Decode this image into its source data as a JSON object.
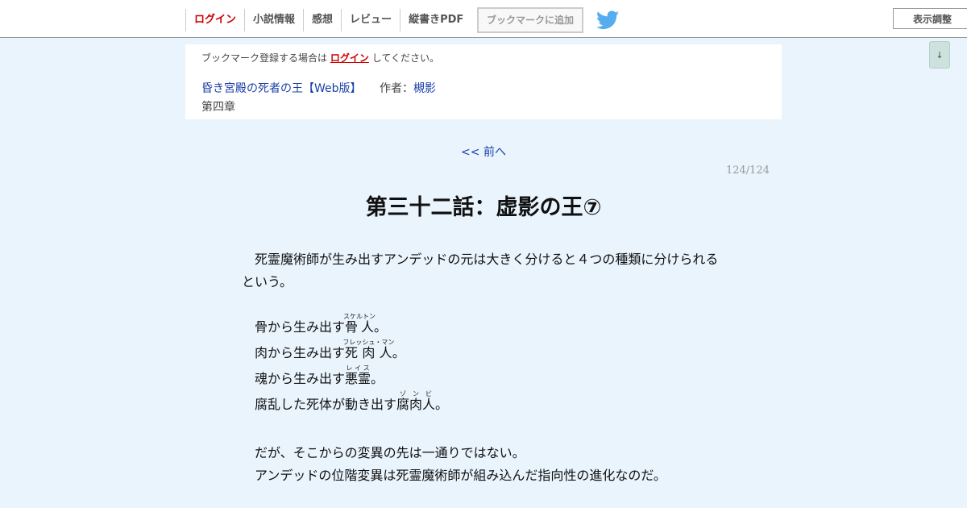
{
  "nav": {
    "items": [
      "ログイン",
      "小説情報",
      "感想",
      "レビュー",
      "縦書きPDF"
    ],
    "bookmark_button": "ブックマークに追加",
    "display_settings": "表示調整",
    "scroll_down": "↓"
  },
  "info": {
    "notice_prefix": "ブックマーク登録する場合は",
    "notice_link": "ログイン",
    "notice_suffix": "してください。",
    "series_title": "昏き宮殿の死者の王【Web版】",
    "author_label": "作者：",
    "author_name": "槻影",
    "chapter": "第四章"
  },
  "pager": {
    "prev": "<< 前へ",
    "page_count": "124/124"
  },
  "chapter_title": "第三十二話：虚影の王⑦",
  "body": {
    "p1_line1": "死霊魔術師が生み出すアンデッドの元は大きく分けると４つの種類に分けられる",
    "p1_line2": "という。",
    "l1_pre": "骨から生み出す",
    "l1_base": "骨人",
    "l1_ruby": "スケルトン",
    "l1_post": "。",
    "l2_pre": "肉から生み出す",
    "l2_base": "死肉人",
    "l2_ruby": "フレッシュ・マン",
    "l2_post": "。",
    "l3_pre": "魂から生み出す",
    "l3_base": "悪霊",
    "l3_ruby": "レイス",
    "l3_post": "。",
    "l4_pre": "腐乱した死体が動き出す",
    "l4_base": "腐肉人",
    "l4_ruby": "ゾンビ",
    "l4_post": "。",
    "p3_line1": "だが、そこからの変異の先は一通りではない。",
    "p3_line2": "アンデッドの位階変異は死霊魔術師が組み込んだ指向性の進化なのだ。"
  }
}
